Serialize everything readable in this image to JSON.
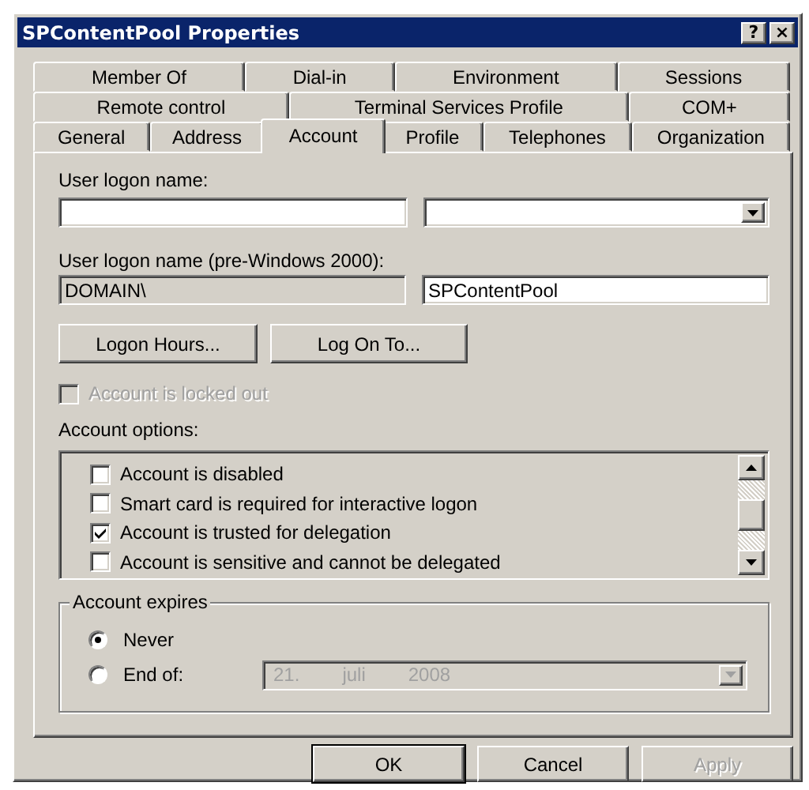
{
  "window": {
    "title": "SPContentPool Properties",
    "help_button": "?",
    "close_button": "×"
  },
  "tab_rows": [
    [
      {
        "label": "Member Of",
        "selected": false
      },
      {
        "label": "Dial-in",
        "selected": false
      },
      {
        "label": "Environment",
        "selected": false
      },
      {
        "label": "Sessions",
        "selected": false
      }
    ],
    [
      {
        "label": "Remote control",
        "selected": false
      },
      {
        "label": "Terminal Services Profile",
        "selected": false
      },
      {
        "label": "COM+",
        "selected": false
      }
    ],
    [
      {
        "label": "General",
        "selected": false
      },
      {
        "label": "Address",
        "selected": false
      },
      {
        "label": "Account",
        "selected": true
      },
      {
        "label": "Profile",
        "selected": false
      },
      {
        "label": "Telephones",
        "selected": false
      },
      {
        "label": "Organization",
        "selected": false
      }
    ]
  ],
  "user_logon_name": {
    "label": "User logon name:"
  },
  "pre_windows_2000": {
    "label": "User logon name (pre-Windows 2000):",
    "domain": "DOMAIN\\",
    "name": "SPContentPool"
  },
  "buttons": [
    "Logon Hours...",
    "Log On To..."
  ],
  "locked_out": {
    "label": "Account is locked out",
    "checked": false,
    "disabled": true
  },
  "account_options": {
    "label": "Account options:",
    "items": [
      {
        "label": "Account is disabled",
        "checked": false
      },
      {
        "label": "Smart card is required for interactive logon",
        "checked": false
      },
      {
        "label": "Account is trusted for delegation",
        "checked": true
      },
      {
        "label": "Account is sensitive and cannot be delegated",
        "checked": false
      }
    ]
  },
  "account_expires": {
    "label": "Account expires",
    "options": [
      {
        "label": "Never",
        "selected": true
      },
      {
        "label": "End of:",
        "selected": false
      }
    ],
    "date": {
      "day": "21.",
      "month": "juli",
      "year": "2008",
      "disabled": true
    }
  },
  "dialog_buttons": [
    {
      "label": "OK",
      "default": true,
      "disabled": false
    },
    {
      "label": "Cancel",
      "default": false,
      "disabled": false
    },
    {
      "label": "Apply",
      "default": false,
      "disabled": true
    }
  ]
}
